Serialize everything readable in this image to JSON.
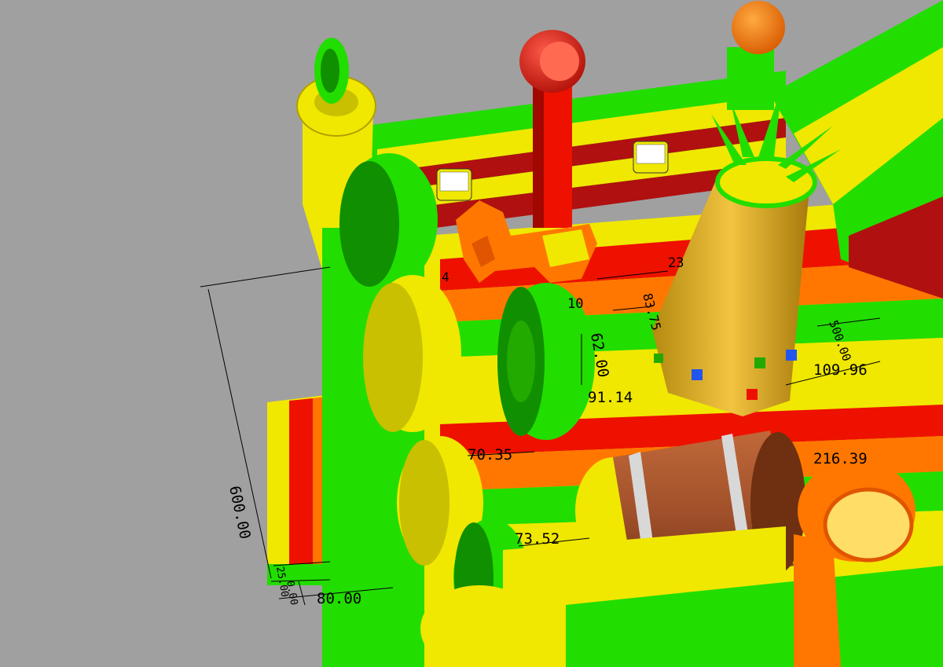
{
  "viewport": {
    "background": "#a0a0a0",
    "model": "inflatable fruit-themed bouncy castle with slide"
  },
  "dimensions": {
    "height_600": "600.00",
    "width_80": "80.00",
    "small_25": "25.00",
    "small_0": "0.00",
    "d_216": "216.39",
    "d_110": "109.96",
    "d_91": "91.14",
    "d_62": "62.00",
    "d_83": "83.75",
    "d_70": "70.35",
    "d_73": "73.52",
    "d_500": "500.00",
    "d_23": "23",
    "d_10": "10",
    "d_4": "4"
  },
  "colors": {
    "green": "#22dd00",
    "yellow": "#f0e800",
    "red": "#ee1100",
    "orange": "#ff7700",
    "dark_red": "#b01010",
    "brown": "#8a3a10"
  }
}
